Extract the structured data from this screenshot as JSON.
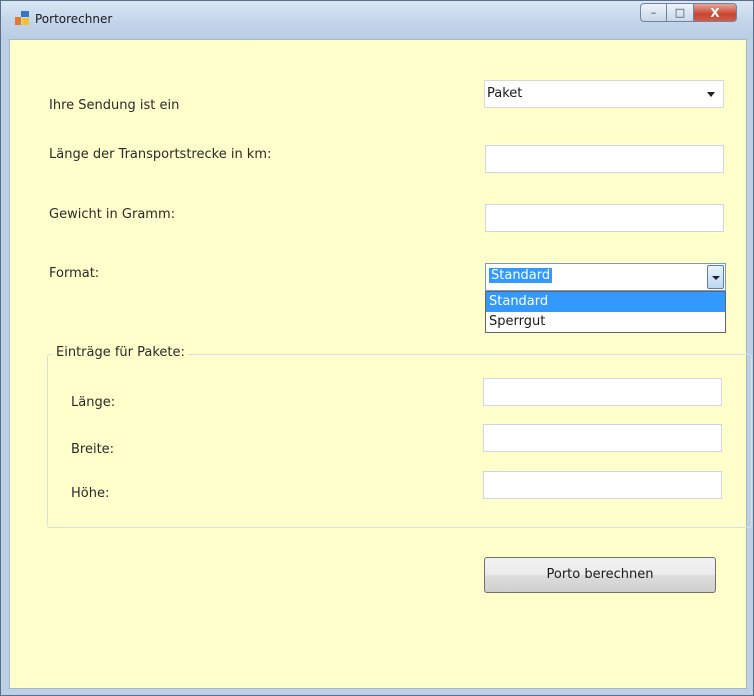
{
  "window": {
    "title": "Portorechner",
    "controls": {
      "minimize": "–",
      "maximize": "□",
      "close": "X"
    }
  },
  "form": {
    "shipment_label": "Ihre Sendung ist ein",
    "shipment_type": {
      "selected": "Paket"
    },
    "distance_label": "Länge der Transportstrecke in km:",
    "distance_value": "",
    "weight_label": "Gewicht in Gramm:",
    "weight_value": "",
    "format_label": "Format:",
    "format": {
      "selected": "Standard",
      "options": [
        "Standard",
        "Sperrgut"
      ],
      "highlighted_index": 0
    }
  },
  "package_group": {
    "legend": "Einträge für Pakete:",
    "length_label": "Länge:",
    "length_value": "",
    "width_label": "Breite:",
    "width_value": "",
    "height_label": "Höhe:",
    "height_value": ""
  },
  "actions": {
    "calculate_label": "Porto berechnen"
  },
  "icons": {
    "app": "app-window-icon",
    "dropdown": "chevron-down-icon"
  },
  "colors": {
    "form_background": "#ffffcc",
    "selection_highlight": "#3399ff",
    "close_button": "#c9452f",
    "window_frame": "#bcd0e6"
  }
}
